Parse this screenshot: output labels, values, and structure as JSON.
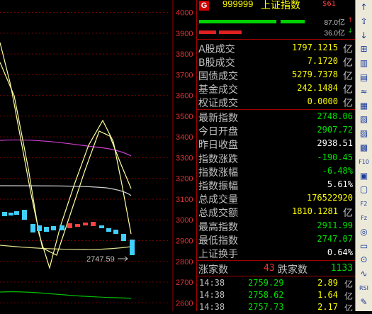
{
  "header": {
    "badge": "G",
    "code": "999999",
    "name": "上证指数",
    "tag": "$61"
  },
  "volume_bars": {
    "top_label": "87.0亿",
    "bottom_label": "36.0亿",
    "top_green_fraction": 0.75,
    "bottom_red_fraction": 0.34
  },
  "turnover": [
    {
      "label": "A股成交",
      "value": "1797.1215",
      "unit": "亿",
      "color": "y"
    },
    {
      "label": "B股成交",
      "value": "7.1720",
      "unit": "亿",
      "color": "y"
    },
    {
      "label": "国债成交",
      "value": "5279.7378",
      "unit": "亿",
      "color": "y"
    },
    {
      "label": "基金成交",
      "value": "242.1484",
      "unit": "亿",
      "color": "y"
    },
    {
      "label": "权证成交",
      "value": "0.0000",
      "unit": "亿",
      "color": "y"
    }
  ],
  "stats": [
    {
      "label": "最新指数",
      "value": "2748.06",
      "color": "g"
    },
    {
      "label": "今日开盘",
      "value": "2907.72",
      "color": "g"
    },
    {
      "label": "昨日收盘",
      "value": "2938.51",
      "color": "w"
    },
    {
      "label": "指数涨跌",
      "value": "-190.45",
      "color": "g"
    },
    {
      "label": "指数涨幅",
      "value": "-6.48%",
      "color": "g"
    },
    {
      "label": "指数振幅",
      "value": "5.61%",
      "color": "w"
    },
    {
      "label": "总成交量",
      "value": "176522920",
      "color": "y"
    },
    {
      "label": "总成交额",
      "value": "1810.1281",
      "unit": "亿",
      "color": "y"
    },
    {
      "label": "最高指数",
      "value": "2911.99",
      "color": "g"
    },
    {
      "label": "最低指数",
      "value": "2747.07",
      "color": "g"
    },
    {
      "label": "上证换手",
      "value": "0.64%",
      "color": "w"
    }
  ],
  "breadth": {
    "up_label": "涨家数",
    "up_count": "43",
    "down_label": "跌家数",
    "down_count": "1133"
  },
  "ticks": [
    {
      "time": "14:38",
      "price": "2759.29",
      "vol": "2.89",
      "unit": "亿"
    },
    {
      "time": "14:38",
      "price": "2758.62",
      "vol": "1.64",
      "unit": "亿"
    },
    {
      "time": "14:38",
      "price": "2757.73",
      "vol": "2.17",
      "unit": "亿"
    }
  ],
  "chart_data": {
    "type": "line",
    "y_ticks": [
      "4000",
      "3900",
      "3800",
      "3700",
      "3600",
      "3500",
      "3400",
      "3300",
      "3200",
      "3100",
      "3000",
      "2900",
      "2800",
      "2700",
      "2600"
    ],
    "last_price_label": "2747.59",
    "ylim": [
      2560,
      4060
    ]
  },
  "toolbar": {
    "buttons": [
      "↑",
      "⇧",
      "↓",
      "⊞",
      "▥",
      "▤",
      "≈",
      "▦",
      "▧",
      "▨",
      "▩",
      "F10",
      "▣",
      "▢",
      "F2",
      "Fz",
      "◎",
      "▭",
      "⊙",
      "∿",
      "RSI",
      "✎"
    ]
  }
}
